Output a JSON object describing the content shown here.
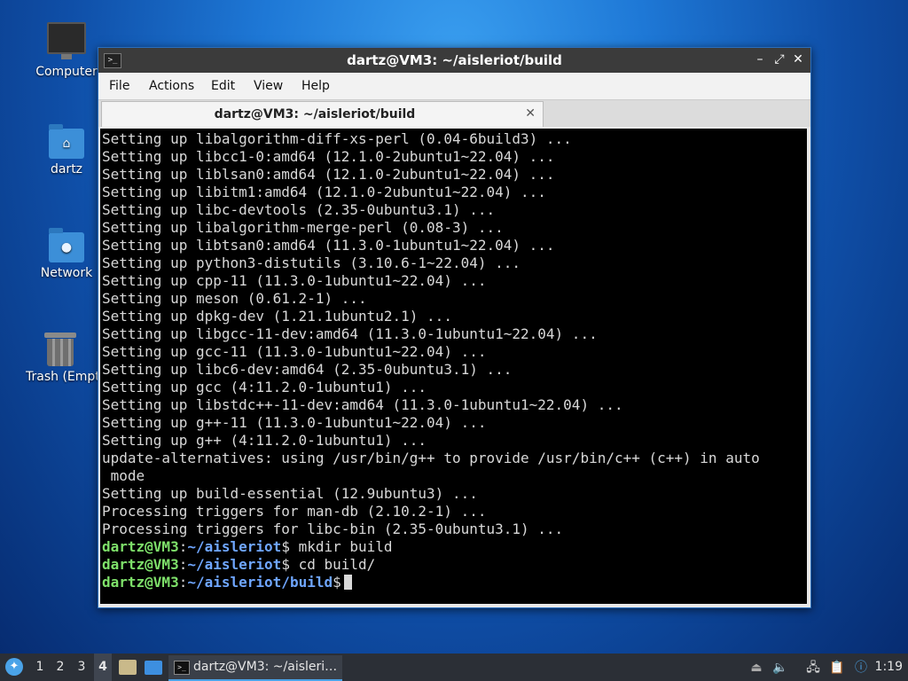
{
  "desktop": {
    "icons": [
      {
        "label": "Computer",
        "icon": "computer-icon"
      },
      {
        "label": "dartz",
        "icon": "home-folder-icon"
      },
      {
        "label": "Network",
        "icon": "network-folder-icon"
      },
      {
        "label": "Trash (Empty)",
        "icon": "trash-icon"
      }
    ]
  },
  "window": {
    "title": "dartz@VM3: ~/aisleriot/build",
    "menu": [
      "File",
      "Edit",
      "View",
      "Help",
      "Actions"
    ],
    "tab_label": "dartz@VM3: ~/aisleriot/build",
    "terminal_lines": [
      "Setting up libalgorithm-diff-xs-perl (0.04-6build3) ...",
      "Setting up libcc1-0:amd64 (12.1.0-2ubuntu1~22.04) ...",
      "Setting up liblsan0:amd64 (12.1.0-2ubuntu1~22.04) ...",
      "Setting up libitm1:amd64 (12.1.0-2ubuntu1~22.04) ...",
      "Setting up libc-devtools (2.35-0ubuntu3.1) ...",
      "Setting up libalgorithm-merge-perl (0.08-3) ...",
      "Setting up libtsan0:amd64 (11.3.0-1ubuntu1~22.04) ...",
      "Setting up python3-distutils (3.10.6-1~22.04) ...",
      "Setting up cpp-11 (11.3.0-1ubuntu1~22.04) ...",
      "Setting up meson (0.61.2-1) ...",
      "Setting up dpkg-dev (1.21.1ubuntu2.1) ...",
      "Setting up libgcc-11-dev:amd64 (11.3.0-1ubuntu1~22.04) ...",
      "Setting up gcc-11 (11.3.0-1ubuntu1~22.04) ...",
      "Setting up libc6-dev:amd64 (2.35-0ubuntu3.1) ...",
      "Setting up gcc (4:11.2.0-1ubuntu1) ...",
      "Setting up libstdc++-11-dev:amd64 (11.3.0-1ubuntu1~22.04) ...",
      "Setting up g++-11 (11.3.0-1ubuntu1~22.04) ...",
      "Setting up g++ (4:11.2.0-1ubuntu1) ...",
      "update-alternatives: using /usr/bin/g++ to provide /usr/bin/c++ (c++) in auto",
      " mode",
      "Setting up build-essential (12.9ubuntu3) ...",
      "Processing triggers for man-db (2.10.2-1) ...",
      "Processing triggers for libc-bin (2.35-0ubuntu3.1) ..."
    ],
    "prompts": [
      {
        "user": "dartz@VM3",
        "path": "~/aisleriot",
        "command": " mkdir build"
      },
      {
        "user": "dartz@VM3",
        "path": "~/aisleriot",
        "command": " cd build/"
      },
      {
        "user": "dartz@VM3",
        "path": "~/aisleriot/build",
        "command": ""
      }
    ]
  },
  "taskbar": {
    "workspaces": [
      "1",
      "2",
      "3",
      "4"
    ],
    "active_workspace": "4",
    "task_label": "dartz@VM3: ~/aisleri…",
    "clock": "1:19"
  }
}
